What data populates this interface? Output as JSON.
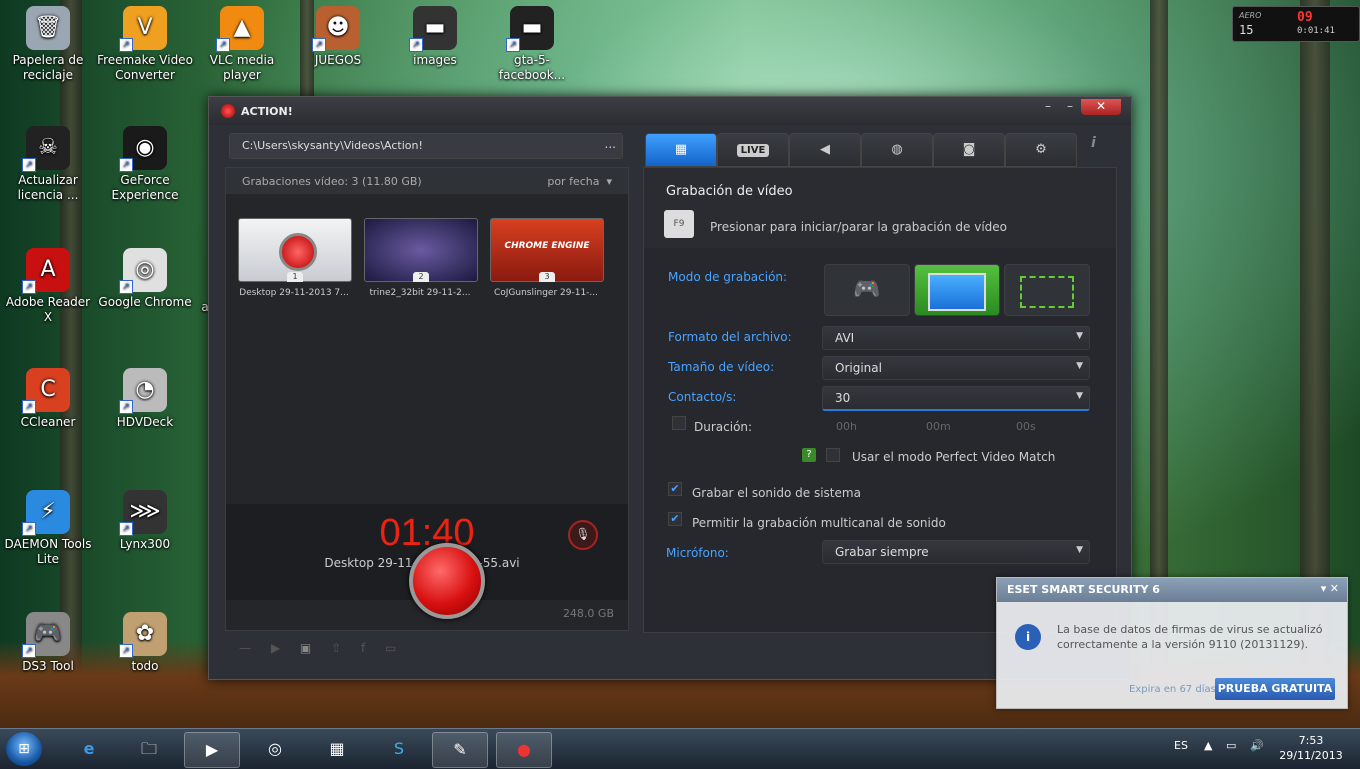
{
  "desktop": {
    "icons": [
      {
        "label": "Papelera de reciclaje",
        "color": "#9aa6b2",
        "glyph": "🗑"
      },
      {
        "label": "Freemake Video Converter",
        "color": "#f0a020",
        "glyph": "V"
      },
      {
        "label": "VLC media player",
        "color": "#f08a10",
        "glyph": "▲"
      },
      {
        "label": "JUEGOS",
        "color": "#b86030",
        "glyph": "☻"
      },
      {
        "label": "images",
        "color": "#333333",
        "glyph": "▬"
      },
      {
        "label": "gta-5-facebook...",
        "color": "#222222",
        "glyph": "▬"
      },
      {
        "label": "Actualizar licencia ...",
        "color": "#222222",
        "glyph": "☠"
      },
      {
        "label": "GeForce Experience",
        "color": "#1a1a1a",
        "glyph": "◉"
      },
      {
        "label": "Adobe Reader X",
        "color": "#c81010",
        "glyph": "A"
      },
      {
        "label": "Google Chrome",
        "color": "#e0e0e0",
        "glyph": "◎"
      },
      {
        "label": "CCleaner",
        "color": "#d84020",
        "glyph": "C"
      },
      {
        "label": "HDVDeck",
        "color": "#bbbbbb",
        "glyph": "◔"
      },
      {
        "label": "DAEMON Tools Lite",
        "color": "#2a8ae0",
        "glyph": "⚡"
      },
      {
        "label": "Lynx300",
        "color": "#333333",
        "glyph": "⋙"
      },
      {
        "label": "DS3 Tool",
        "color": "#888888",
        "glyph": "🎮"
      },
      {
        "label": "todo",
        "color": "#c0a070",
        "glyph": "✿"
      }
    ],
    "clipped_label": "a"
  },
  "gadget": {
    "aero": "AERO",
    "num": "15",
    "red": "09",
    "time": "0:01:41"
  },
  "app": {
    "title": "ACTION!",
    "path": "C:\\Users\\skysanty\\Videos\\Action!",
    "path_more": "...",
    "recordings_header": "Grabaciones vídeo: 3 (11.80 GB)",
    "sort": "por fecha",
    "thumbs": [
      {
        "num": "1",
        "caption": "Desktop 29-11-2013 7..."
      },
      {
        "num": "2",
        "caption": "trine2_32bit 29-11-2..."
      },
      {
        "num": "3",
        "caption": "CoJGunslinger 29-11-..."
      }
    ],
    "thumb3_text": "CHROME ENGINE",
    "timer": "01:40",
    "timer_file": "Desktop 29-11-2013 7-51-55.avi",
    "disk": "248.0 GB",
    "tabs": [
      {
        "name": "video",
        "label": "▦"
      },
      {
        "name": "live",
        "label": "LIVE"
      },
      {
        "name": "audio",
        "label": "◀"
      },
      {
        "name": "benchmark",
        "label": "◍"
      },
      {
        "name": "screenshot",
        "label": "◙"
      },
      {
        "name": "settings",
        "label": "⚙"
      }
    ],
    "info": "i",
    "section_title": "Grabación de vídeo",
    "hotkey": "F9",
    "hotkey_text": "Presionar para iniciar/parar la grabación de vídeo",
    "mode_label": "Modo de grabación:",
    "format_label": "Formato del archivo:",
    "format_value": "AVI",
    "size_label": "Tamaño de vídeo:",
    "size_value": "Original",
    "fps_label": "Contacto/s:",
    "fps_value": "30",
    "duration_label": "Duración:",
    "dur_h": "00h",
    "dur_m": "00m",
    "dur_s": "00s",
    "perfect_match": "Usar el modo Perfect Video Match",
    "help": "?",
    "sys_sound": "Grabar el sonido de sistema",
    "multichannel": "Permitir la grabación multicanal de sonido",
    "mic_label": "Micrófono:",
    "mic_value": "Grabar siempre"
  },
  "eset": {
    "title": "ESET SMART SECURITY 6",
    "message": "La base de datos de firmas de virus se actualizó correctamente a la versión 9110 (20131129).",
    "expires": "Expira en 67 días",
    "trial": "PRUEBA GRATUITA",
    "info": "i"
  },
  "taskbar": {
    "lang": "ES",
    "time": "7:53",
    "date": "29/11/2013"
  }
}
